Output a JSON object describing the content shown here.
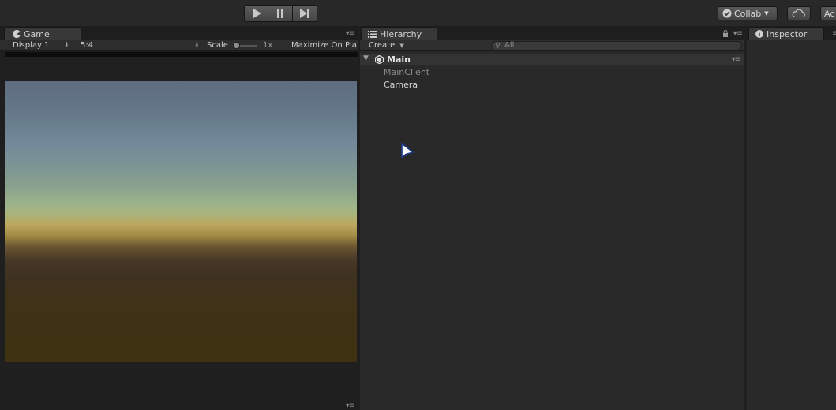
{
  "toolbar": {
    "collab_label": "Collab",
    "account_label": "Ac"
  },
  "game": {
    "tab_label": "Game",
    "display": "Display 1",
    "aspect": "5:4",
    "scale_label": "Scale",
    "scale_value": "1x",
    "maximize_label": "Maximize On Pla"
  },
  "hierarchy": {
    "tab_label": "Hierarchy",
    "create_label": "Create",
    "search_placeholder": "All",
    "scene_name": "Main",
    "items": [
      {
        "label": "MainClient",
        "disabled": true
      },
      {
        "label": "Camera",
        "disabled": false
      }
    ]
  },
  "inspector": {
    "tab_label": "Inspector"
  },
  "colors": {
    "background": "#282828",
    "panel": "#282828",
    "tab_active": "#383838",
    "text": "#d2d2d2",
    "disabled_text": "#8a8a8a"
  }
}
